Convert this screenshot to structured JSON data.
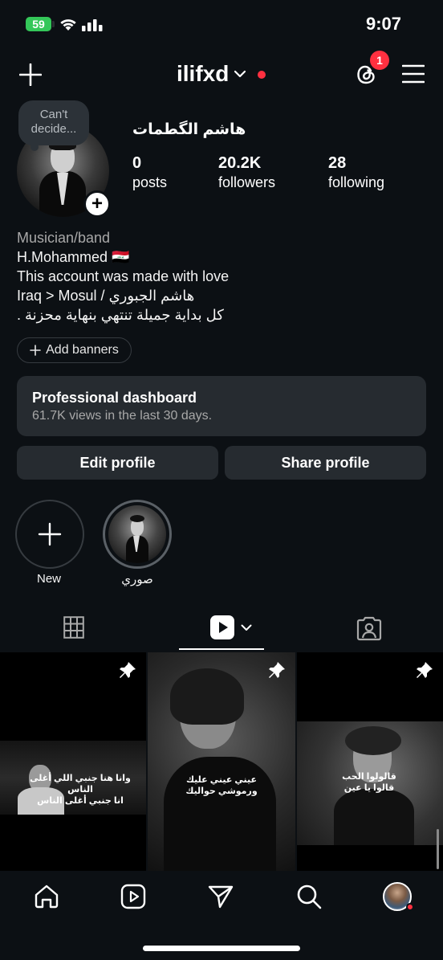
{
  "status_bar": {
    "battery": "59",
    "time": "9:07"
  },
  "header": {
    "username": "ilifxd",
    "notification_count": "1"
  },
  "profile": {
    "note": "Can't decide...",
    "full_name": "هاشم الگطمات",
    "stats": [
      {
        "value": "0",
        "label": "posts"
      },
      {
        "value": "20.2K",
        "label": "followers"
      },
      {
        "value": "28",
        "label": "following"
      }
    ],
    "bio": {
      "category": "Musician/band",
      "line1": "H.Mohammed 🇮🇶",
      "line2": "This account was made with love",
      "line3": "Iraq > Mosul / هاشم الجبوري",
      "line4": "كل بداية جميلة تنتهي بنهاية محزنة ."
    },
    "add_banners": "Add banners"
  },
  "dashboard": {
    "title": "Professional dashboard",
    "subtitle": "61.7K views in the last 30 days."
  },
  "buttons": {
    "edit": "Edit profile",
    "share": "Share profile"
  },
  "highlights": [
    {
      "label": "New"
    },
    {
      "label": "صوري"
    }
  ],
  "grid": [
    {
      "caption": "وانا هنا جنبي اللي أغلى الناس\nانا جنبي أغلى الناس"
    },
    {
      "caption": "عيني عيني عليك\nورموشي حواليك"
    },
    {
      "caption": "قالولوا الحب\nقالوا يا عين"
    }
  ],
  "colors": {
    "background": "#0c1014",
    "accent_red": "#ff3040",
    "card": "#262b30",
    "battery": "#34c759"
  }
}
